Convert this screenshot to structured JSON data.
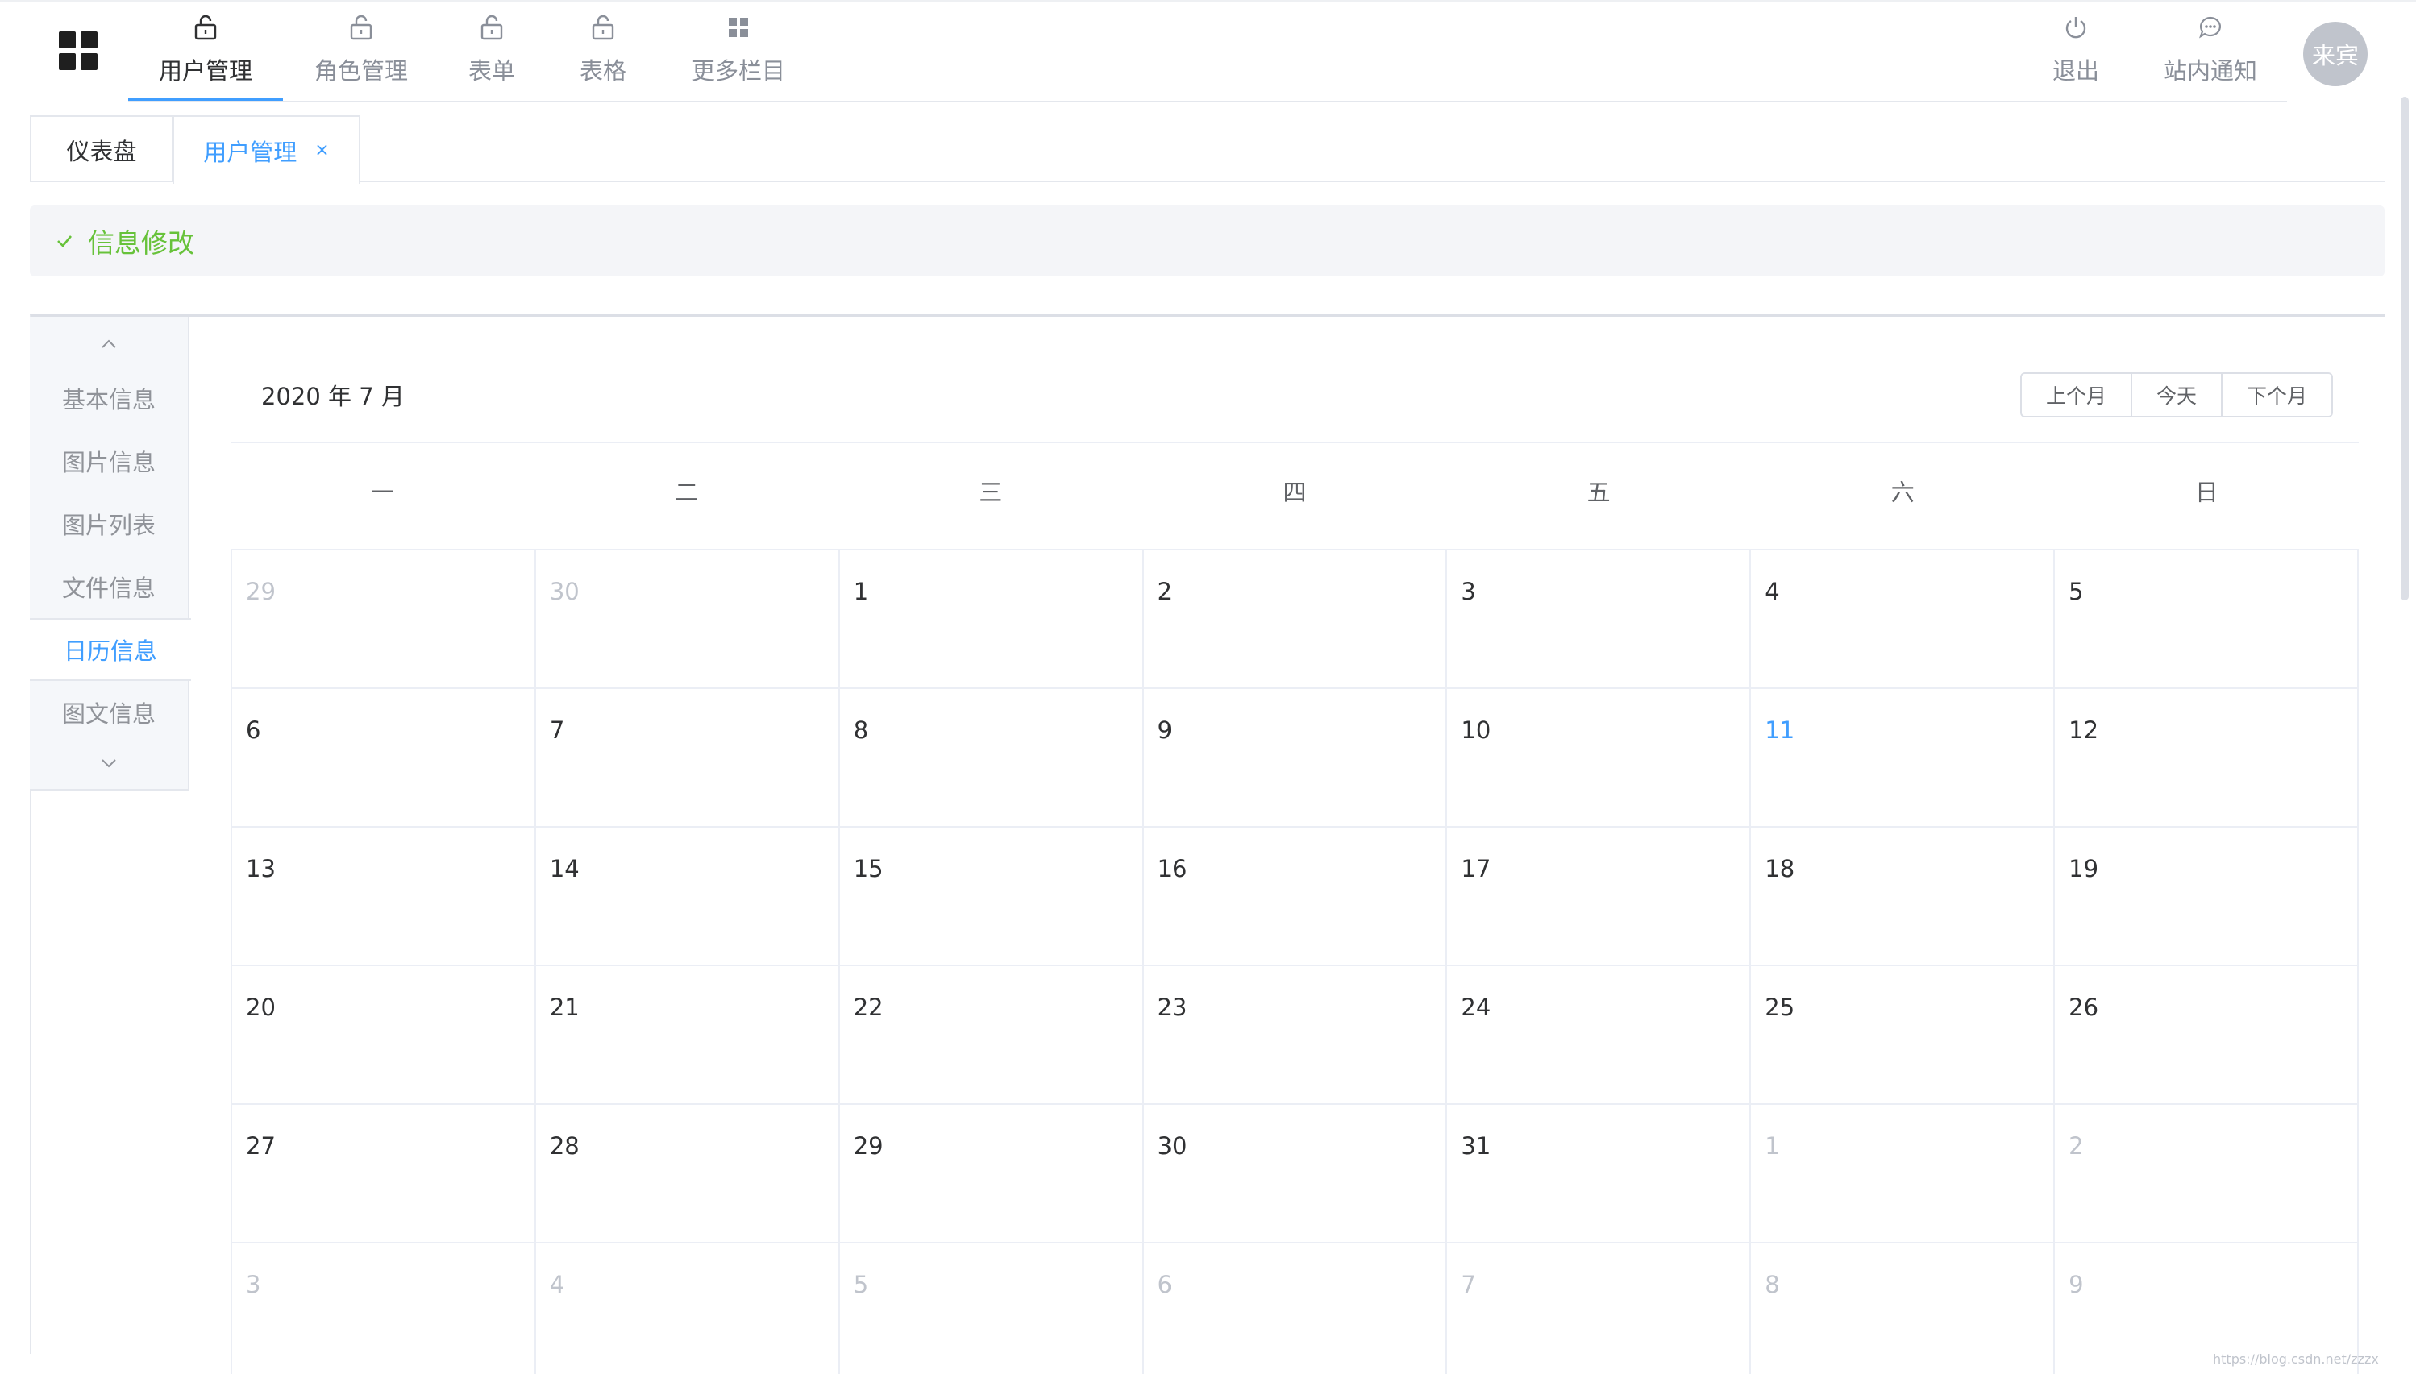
{
  "nav": {
    "items": [
      {
        "label": "用户管理",
        "icon": "lock-icon",
        "active": true
      },
      {
        "label": "角色管理",
        "icon": "lock-icon",
        "active": false
      },
      {
        "label": "表单",
        "icon": "lock-icon",
        "active": false
      },
      {
        "label": "表格",
        "icon": "lock-icon",
        "active": false
      },
      {
        "label": "更多栏目",
        "icon": "grid-icon",
        "active": false
      }
    ],
    "logout": {
      "label": "退出",
      "icon": "power-icon"
    },
    "notice": {
      "label": "站内通知",
      "icon": "chat-icon"
    },
    "avatar": "来宾"
  },
  "tabs": [
    {
      "label": "仪表盘",
      "active": false
    },
    {
      "label": "用户管理",
      "active": true,
      "close": "×"
    }
  ],
  "alert": {
    "title": "信息修改",
    "color": "#67c23a"
  },
  "side_menu": {
    "items": [
      "基本信息",
      "图片信息",
      "图片列表",
      "文件信息",
      "日历信息",
      "图文信息"
    ],
    "active_index": 4
  },
  "calendar": {
    "title": "2020 年 7 月",
    "buttons": {
      "prev": "上个月",
      "today": "今天",
      "next": "下个月"
    },
    "weekdays": [
      "一",
      "二",
      "三",
      "四",
      "五",
      "六",
      "日"
    ],
    "weeks": [
      [
        {
          "d": "29",
          "other": true
        },
        {
          "d": "30",
          "other": true
        },
        {
          "d": "1"
        },
        {
          "d": "2"
        },
        {
          "d": "3"
        },
        {
          "d": "4"
        },
        {
          "d": "5"
        }
      ],
      [
        {
          "d": "6"
        },
        {
          "d": "7"
        },
        {
          "d": "8"
        },
        {
          "d": "9"
        },
        {
          "d": "10"
        },
        {
          "d": "11",
          "today": true
        },
        {
          "d": "12"
        }
      ],
      [
        {
          "d": "13"
        },
        {
          "d": "14"
        },
        {
          "d": "15"
        },
        {
          "d": "16"
        },
        {
          "d": "17"
        },
        {
          "d": "18"
        },
        {
          "d": "19"
        }
      ],
      [
        {
          "d": "20"
        },
        {
          "d": "21"
        },
        {
          "d": "22"
        },
        {
          "d": "23"
        },
        {
          "d": "24"
        },
        {
          "d": "25"
        },
        {
          "d": "26"
        }
      ],
      [
        {
          "d": "27"
        },
        {
          "d": "28"
        },
        {
          "d": "29"
        },
        {
          "d": "30"
        },
        {
          "d": "31"
        },
        {
          "d": "1",
          "other": true
        },
        {
          "d": "2",
          "other": true
        }
      ],
      [
        {
          "d": "3",
          "other": true
        },
        {
          "d": "4",
          "other": true
        },
        {
          "d": "5",
          "other": true
        },
        {
          "d": "6",
          "other": true
        },
        {
          "d": "7",
          "other": true
        },
        {
          "d": "8",
          "other": true
        },
        {
          "d": "9",
          "other": true
        }
      ]
    ]
  },
  "colors": {
    "accent": "#409eff",
    "success": "#67c23a",
    "muted": "#c0c4cc"
  },
  "watermark": "https://blog.csdn.net/zzzx"
}
